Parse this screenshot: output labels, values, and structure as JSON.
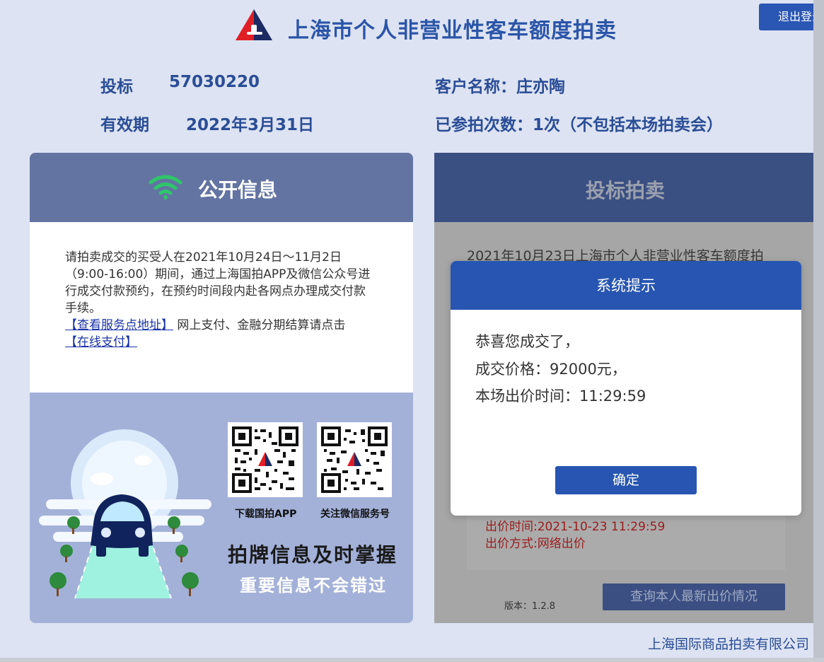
{
  "header": {
    "title": "上海市个人非营业性客车额度拍卖",
    "logout_label": "退出登录"
  },
  "info": {
    "bid_label": "投标",
    "bid_number": "57030220",
    "valid_label": "有效期",
    "valid_date": "2022年3月31日",
    "customer_label": "客户名称：",
    "customer_name": "庄亦陶",
    "attempts_text": "已参拍次数：1次（不包括本场拍卖会）"
  },
  "public_info": {
    "title": "公开信息",
    "notice_text": "请拍卖成交的买受人在2021年10月24日～11月2日（9:00-16:00）期间，通过上海国拍APP及微信公众号进行成交付款预约，在预约时间段内赴各网点办理成交付款手续。",
    "service_link": "【查看服务点地址】",
    "mid_text": " 网上支付、金融分期结算请点击",
    "pay_link": "【在线支付】",
    "qr1_caption": "下载国拍APP",
    "qr2_caption": "关注微信服务号",
    "promo_line1": "拍牌信息及时掌握",
    "promo_line2": "重要信息不会错过"
  },
  "bidding": {
    "title": "投标拍卖",
    "auction_title": "2021年10月23日上海市个人非营业性客车额度拍",
    "bid_time": "出价时间:2021-10-23 11:29:59",
    "bid_method": "出价方式:网络出价",
    "version": "版本：1.2.8",
    "query_button": "查询本人最新出价情况"
  },
  "modal": {
    "title": "系统提示",
    "line1": "恭喜您成交了，",
    "line2": "成交价格：92000元，",
    "line3": "本场出价时间：11:29:59",
    "ok_button": "确定"
  },
  "footer": {
    "company": "上海国际商品拍卖有限公司"
  },
  "colors": {
    "primary": "#2755b1",
    "header_text": "#2b55a8",
    "wifi_green": "#2fc66a"
  },
  "icons": [
    "logo-icon",
    "wifi-icon",
    "qr-code-icon",
    "car-illustration"
  ]
}
